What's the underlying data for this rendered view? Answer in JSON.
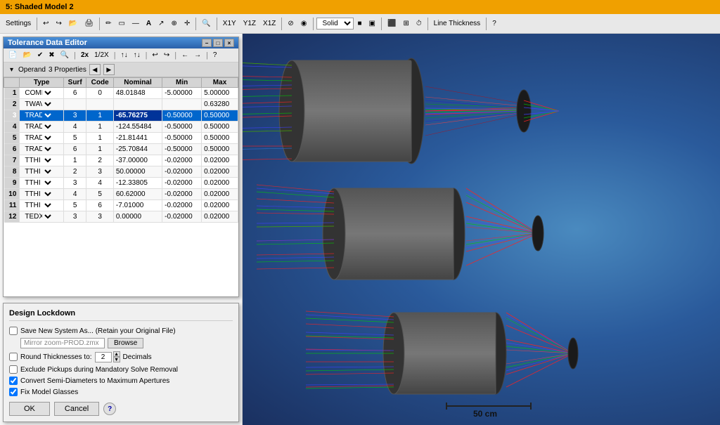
{
  "titlebar": {
    "label": "5: Shaded Model 2"
  },
  "toolbar": {
    "settings_label": "Settings",
    "solid_label": "Solid",
    "line_thickness_label": "Line Thickness",
    "help_label": "?",
    "axis_labels": [
      "X1Y",
      "Y1Z",
      "X1Z"
    ]
  },
  "tde": {
    "title": "Tolerance Data Editor",
    "operand_label": "Operand",
    "properties_label": "3 Properties",
    "columns": [
      "",
      "Type",
      "Surf",
      "Code",
      "Nominal",
      "Min",
      "Max"
    ],
    "rows": [
      {
        "num": "1",
        "type": "COMP",
        "surf": "6",
        "code": "0",
        "nominal": "48.01848",
        "min": "-5.00000",
        "max": "5.00000",
        "selected": false
      },
      {
        "num": "2",
        "type": "TWAV",
        "surf": "",
        "code": "",
        "nominal": "",
        "min": "",
        "max": "0.63280",
        "selected": false
      },
      {
        "num": "3",
        "type": "TRAD",
        "surf": "3",
        "code": "1",
        "nominal": "-65.76275",
        "min": "-0.50000",
        "max": "0.50000",
        "selected": true
      },
      {
        "num": "4",
        "type": "TRAD",
        "surf": "4",
        "code": "1",
        "nominal": "-124.55484",
        "min": "-0.50000",
        "max": "0.50000",
        "selected": false
      },
      {
        "num": "5",
        "type": "TRAD",
        "surf": "5",
        "code": "1",
        "nominal": "-21.81441",
        "min": "-0.50000",
        "max": "0.50000",
        "selected": false
      },
      {
        "num": "6",
        "type": "TRAD",
        "surf": "6",
        "code": "1",
        "nominal": "-25.70844",
        "min": "-0.50000",
        "max": "0.50000",
        "selected": false
      },
      {
        "num": "7",
        "type": "TTHI",
        "surf": "1",
        "code": "2",
        "nominal": "-37.00000",
        "min": "-0.02000",
        "max": "0.02000",
        "selected": false
      },
      {
        "num": "8",
        "type": "TTHI",
        "surf": "2",
        "code": "3",
        "nominal": "50.00000",
        "min": "-0.02000",
        "max": "0.02000",
        "selected": false
      },
      {
        "num": "9",
        "type": "TTHI",
        "surf": "3",
        "code": "4",
        "nominal": "-12.33805",
        "min": "-0.02000",
        "max": "0.02000",
        "selected": false
      },
      {
        "num": "10",
        "type": "TTHI",
        "surf": "4",
        "code": "5",
        "nominal": "60.62000",
        "min": "-0.02000",
        "max": "0.02000",
        "selected": false
      },
      {
        "num": "11",
        "type": "TTHI",
        "surf": "5",
        "code": "6",
        "nominal": "-7.01000",
        "min": "-0.02000",
        "max": "0.02000",
        "selected": false
      },
      {
        "num": "12",
        "type": "TEDX",
        "surf": "3",
        "code": "3",
        "nominal": "0.00000",
        "min": "-0.02000",
        "max": "0.02000",
        "selected": false
      }
    ]
  },
  "design_lockdown": {
    "title": "Design Lockdown",
    "save_label": "Save New System As... (Retain your Original File)",
    "save_checked": false,
    "filename_placeholder": "Mirror zoom-PROD.zmx",
    "browse_label": "Browse",
    "round_label": "Round Thicknesses to:",
    "round_checked": false,
    "round_value": "2",
    "decimals_label": "Decimals",
    "exclude_label": "Exclude Pickups during Mandatory Solve Removal",
    "exclude_checked": false,
    "convert_label": "Convert Semi-Diameters to Maximum Apertures",
    "convert_checked": true,
    "fix_label": "Fix Model Glasses",
    "fix_checked": true,
    "ok_label": "OK",
    "cancel_label": "Cancel"
  },
  "scale_bar": {
    "label": "50 cm"
  },
  "icons": {
    "minimize": "−",
    "restore": "□",
    "close": "×",
    "left_arrow": "◀",
    "right_arrow": "▶",
    "help": "?"
  }
}
